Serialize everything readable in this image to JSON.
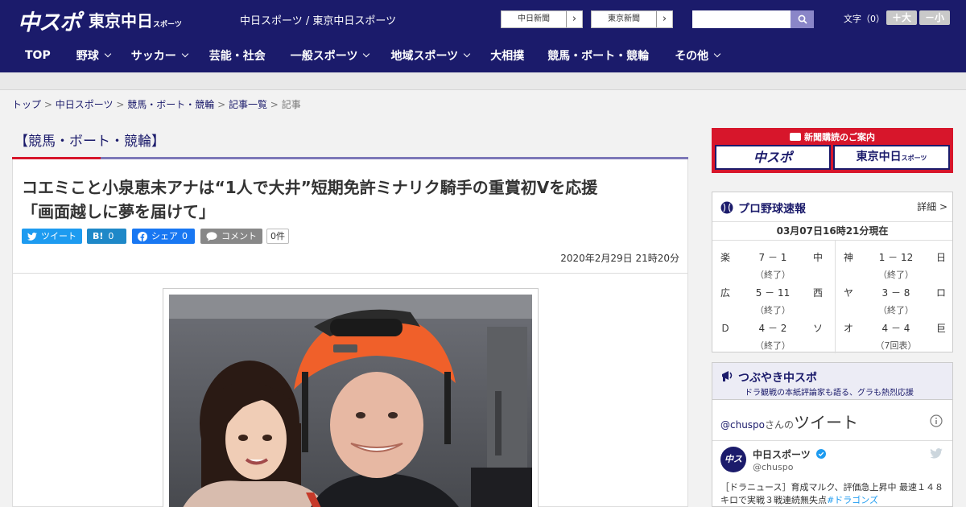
{
  "header": {
    "logo_main": "中スポ",
    "logo_sub": "東京中日",
    "logo_sub_small": "スポーツ",
    "site_title": "中日スポーツ / 東京中日スポーツ",
    "ext_links": [
      {
        "label": "中日新聞"
      },
      {
        "label": "東京新聞"
      }
    ],
    "search_placeholder": "",
    "font_size": {
      "label": "文字（0）",
      "larger": "＋大",
      "smaller": "－小"
    }
  },
  "nav": {
    "items": [
      {
        "label": "TOP",
        "has_dropdown": false
      },
      {
        "label": "野球",
        "has_dropdown": true
      },
      {
        "label": "サッカー",
        "has_dropdown": true
      },
      {
        "label": "芸能・社会",
        "has_dropdown": false
      },
      {
        "label": "一般スポーツ",
        "has_dropdown": true
      },
      {
        "label": "地域スポーツ",
        "has_dropdown": true
      },
      {
        "label": "大相撲",
        "has_dropdown": false
      },
      {
        "label": "競馬・ボート・競輪",
        "has_dropdown": false
      },
      {
        "label": "その他",
        "has_dropdown": true
      }
    ]
  },
  "breadcrumb": {
    "items": [
      "トップ",
      "中日スポーツ",
      "競馬・ボート・競輪",
      "記事一覧"
    ],
    "current": "記事",
    "separator": ">"
  },
  "article": {
    "section": "【競馬・ボート・競輪】",
    "headline_line1": "コエミこと小泉恵未アナは“1人で大井”短期免許ミナリク騎手の重賞初Vを応援",
    "headline_line2": "「画面越しに夢を届けて」",
    "share": {
      "tweet": "ツイート",
      "hatena_icon": "B!",
      "hatena_count": "0",
      "facebook": "シェア",
      "facebook_count": "0",
      "comment": "コメント",
      "comment_count": "0件"
    },
    "date": "2020年2月29日 21時20分"
  },
  "sidebar": {
    "ad": {
      "title": "新聞購読のご案内",
      "logo_left": "中スポ",
      "logo_right": "東京中日",
      "logo_right_small": "スポーツ"
    },
    "baseball": {
      "title": "プロ野球速報",
      "detail": "詳細 >",
      "timestamp": "03月07日16時21分現在",
      "games": [
        {
          "home": "楽",
          "score": "7 － 1",
          "away": "中",
          "status": "（終了）"
        },
        {
          "home": "神",
          "score": "1 － 12",
          "away": "日",
          "status": "（終了）"
        },
        {
          "home": "広",
          "score": "5 － 11",
          "away": "西",
          "status": "（終了）"
        },
        {
          "home": "ヤ",
          "score": "3 － 8",
          "away": "ロ",
          "status": "（終了）"
        },
        {
          "home": "Ｄ",
          "score": "4 － 2",
          "away": "ソ",
          "status": "（終了）"
        },
        {
          "home": "オ",
          "score": "4 － 4",
          "away": "巨",
          "status": "（7回表）"
        }
      ]
    },
    "tweets": {
      "title": "つぶやき中スポ",
      "subtitle": "ドラ観戦の本紙評論家も語る、グラも熱烈応援",
      "handle": "@chuspo",
      "handle_suffix": "さんの",
      "heading": "ツイート",
      "avatar_text": "中スポ",
      "author_name": "中日スポーツ",
      "author_handle": "@chuspo",
      "text": "［ドラニュース］育成マルク、評価急上昇中 最速１４８キロで実戦３戦連続無失点",
      "hashtag": "#ドラゴンズ"
    }
  }
}
